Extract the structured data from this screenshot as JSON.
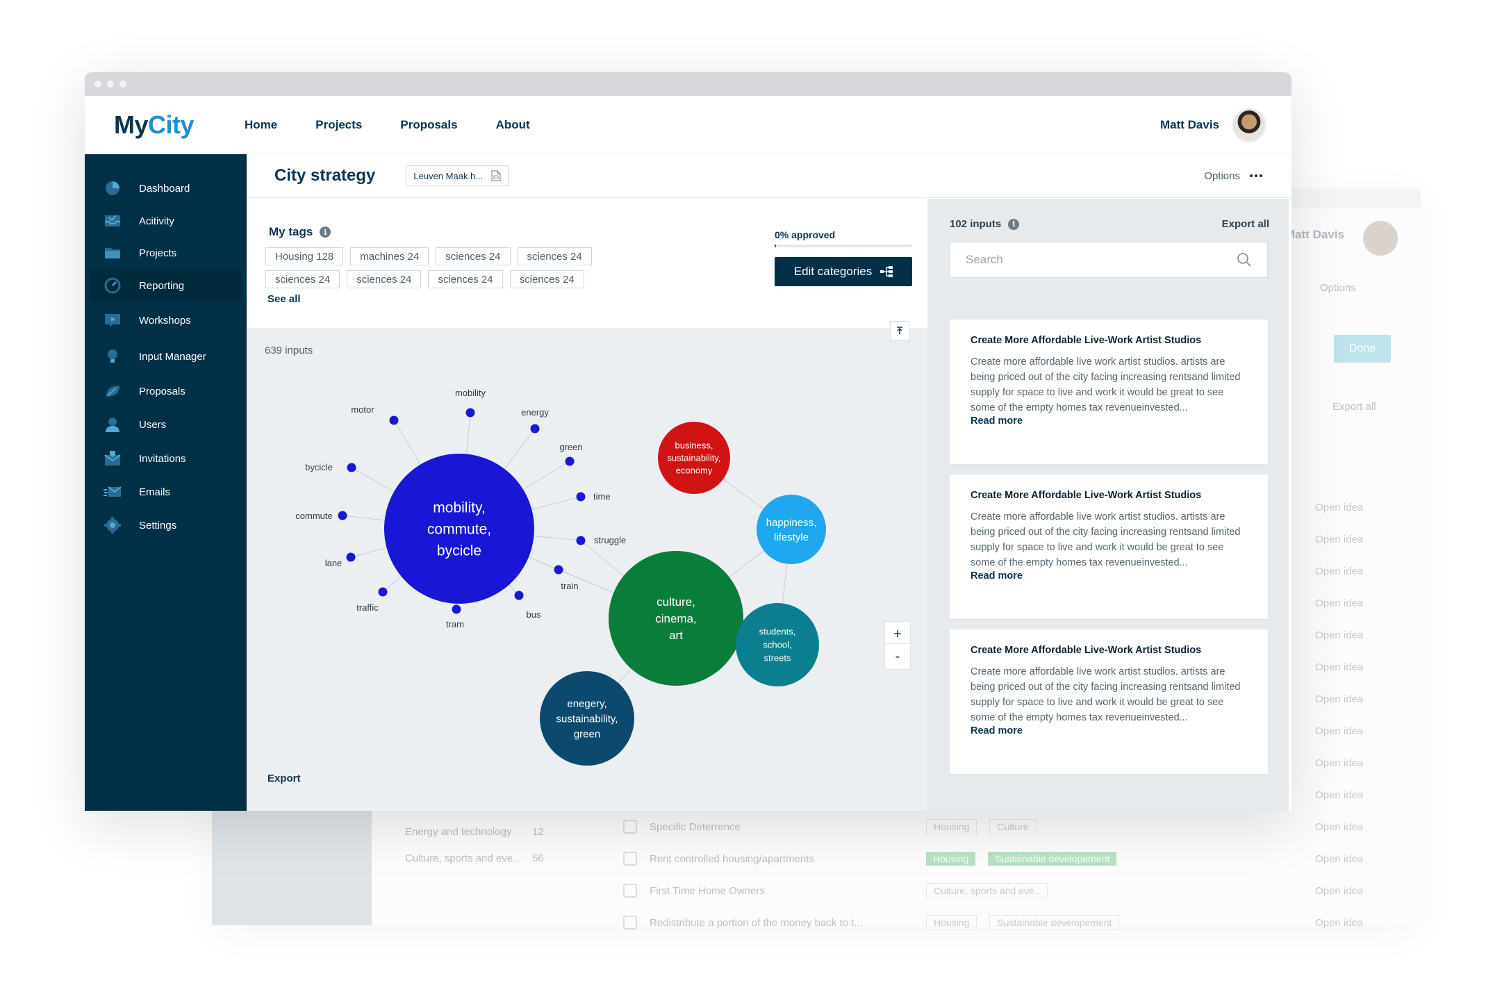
{
  "app": {
    "logo_my": "My",
    "logo_city": "City"
  },
  "nav": {
    "links": [
      "Home",
      "Projects",
      "Proposals",
      "About"
    ]
  },
  "user": {
    "name": "Matt Davis"
  },
  "sidebar": {
    "items": [
      {
        "label": "Dashboard",
        "icon": "pie-chart-icon"
      },
      {
        "label": "Acitivity",
        "icon": "inbox-icon"
      },
      {
        "label": "Projects",
        "icon": "folder-icon"
      },
      {
        "label": "Reporting",
        "icon": "gauge-icon"
      },
      {
        "label": "Workshops",
        "icon": "video-icon"
      },
      {
        "label": "Input Manager",
        "icon": "lightbulb-icon"
      },
      {
        "label": "Proposals",
        "icon": "leaf-icon"
      },
      {
        "label": "Users",
        "icon": "user-icon"
      },
      {
        "label": "Invitations",
        "icon": "envelope-icon"
      },
      {
        "label": "Emails",
        "icon": "fast-mail-icon"
      },
      {
        "label": "Settings",
        "icon": "gear-icon"
      }
    ],
    "active": "Reporting"
  },
  "page": {
    "title": "City strategy",
    "doc_chip": "Leuven Maak h...",
    "options_label": "Options"
  },
  "tags": {
    "title": "My tags",
    "items": [
      "Housing 128",
      "machines 24",
      "sciences 24",
      "sciences 24",
      "sciences 24",
      "sciences 24",
      "sciences 24",
      "sciences 24"
    ],
    "see_all": "See all"
  },
  "approval": {
    "label": "0% approved",
    "fraction": 0.0,
    "button": "Edit categories"
  },
  "viz": {
    "inputs_count": "639 inputs",
    "export": "Export",
    "zoom_in": "+",
    "zoom_out": "-",
    "clusters": [
      {
        "label": [
          "mobility,",
          "commute,",
          "bycicle"
        ],
        "color": "#1a16d6",
        "main": true
      },
      {
        "label": [
          "business,",
          "sustainability,",
          "economy"
        ],
        "color": "#d11313"
      },
      {
        "label": [
          "happiness,",
          "lifestyle"
        ],
        "color": "#1ea7ef"
      },
      {
        "label": [
          "culture,",
          "cinema,",
          "art"
        ],
        "color": "#0a7d3a"
      },
      {
        "label": [
          "students,",
          "school,",
          "streets"
        ],
        "color": "#0b7f8f"
      },
      {
        "label": [
          "enegery,",
          "sustainability,",
          "green"
        ],
        "color": "#0b4a6e"
      }
    ],
    "keywords": [
      "motor",
      "mobility",
      "energy",
      "green",
      "bycicle",
      "time",
      "commute",
      "struggle",
      "lane",
      "train",
      "traffic",
      "tram",
      "bus"
    ],
    "node_color": "#1a16d6"
  },
  "inputs_panel": {
    "count": "102 inputs",
    "export_all": "Export all",
    "search_placeholder": "Search",
    "cards": [
      {
        "title": "Create More Affordable Live-Work Artist Studios",
        "body": "Create more affordable live work artist studios. artists are being priced out of the city facing increasing rentsand limited supply for space to live and work it would be great to see some of the empty homes tax revenueinvested...",
        "read_more": "Read more"
      },
      {
        "title": "Create More Affordable Live-Work Artist Studios",
        "body": "Create more affordable live work artist studios. artists are being priced out of the city facing increasing rentsand limited supply for space to live and work it would be great to see some of the empty homes tax revenueinvested...",
        "read_more": "Read more"
      },
      {
        "title": "Create More Affordable Live-Work Artist Studios",
        "body": "Create more affordable live work artist studios. artists are being priced out of the city facing increasing rentsand limited supply for space to live and work it would be great to see some of the empty homes tax revenueinvested...",
        "read_more": "Read more"
      }
    ]
  },
  "background_window": {
    "user": "Matt Davis",
    "options": "Options",
    "done": "Done",
    "export_all": "Export all",
    "open_idea": "Open idea",
    "categories": [
      {
        "label": "Energy and technology",
        "count": "12"
      },
      {
        "label": "Culture, sports and eve..",
        "count": "56"
      }
    ],
    "rows": [
      {
        "title": "Specific Deterrence",
        "tags": [
          "Housing",
          "Culture"
        ],
        "green": false
      },
      {
        "title": "Rent controlled housing/apartments",
        "tags": [
          "Housing",
          "Sustainable developement"
        ],
        "green": true
      },
      {
        "title": "First Time Home Owners",
        "tags": [
          "Culture, sports and eve.."
        ],
        "green": false
      },
      {
        "title": "Redistribute a portion of the money back to t...",
        "tags": [
          "Housing",
          "Sustainable developement"
        ],
        "green": false
      }
    ]
  }
}
